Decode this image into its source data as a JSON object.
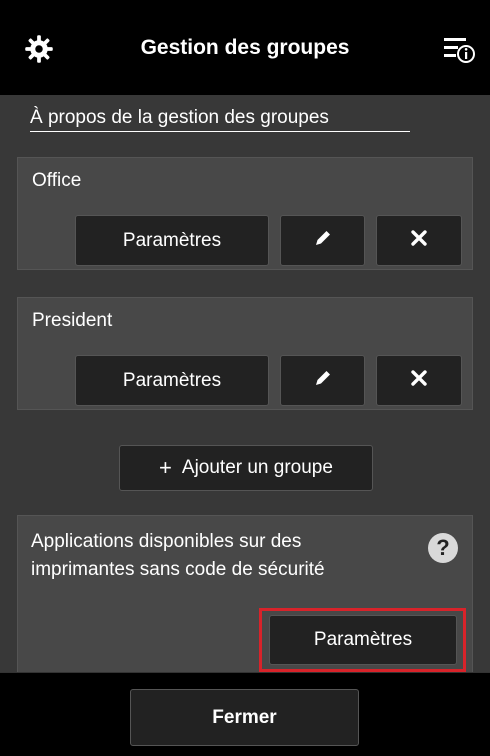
{
  "header": {
    "title": "Gestion des groupes",
    "left_icon": "gear-icon",
    "right_icon": "menu-info-icon"
  },
  "about_link": "À propos de la gestion des groupes",
  "groups": [
    {
      "name": "Office",
      "settings_label": "Paramètres",
      "edit_icon": "pencil-icon",
      "delete_icon": "close-icon"
    },
    {
      "name": "President",
      "settings_label": "Paramètres",
      "edit_icon": "pencil-icon",
      "delete_icon": "close-icon"
    }
  ],
  "add_group": {
    "plus": "+",
    "label": "Ajouter un groupe"
  },
  "apps_section": {
    "text": "Applications disponibles sur des imprimantes sans code de sécurité",
    "help": "?",
    "settings_label": "Paramètres",
    "highlight_color": "#d8232a"
  },
  "footer": {
    "close_label": "Fermer"
  }
}
